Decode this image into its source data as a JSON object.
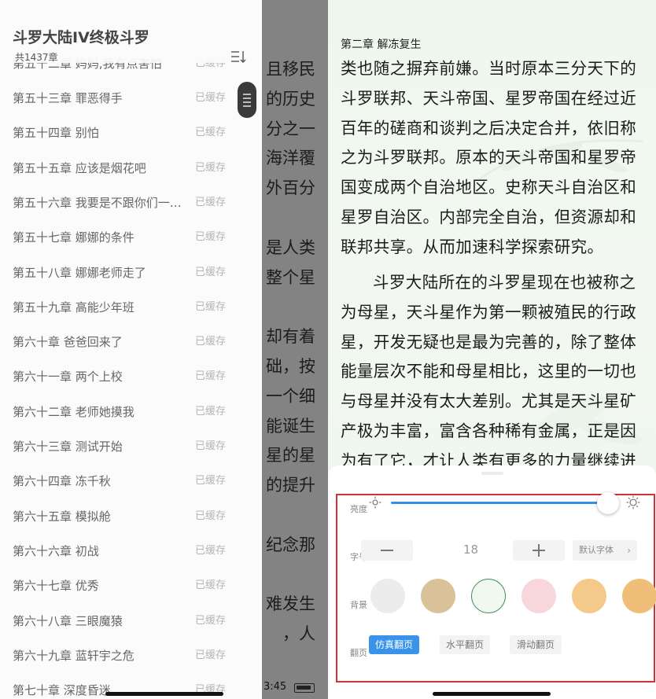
{
  "left_screen": {
    "book_title": "斗罗大陆IV终极斗罗",
    "chapter_count": "共1437章",
    "partial_top_row": {
      "title": "第五十二章 妈妈,我有点害怕",
      "status": "已缓存"
    },
    "chapters": [
      {
        "title": "第五十三章 罪恶得手",
        "status": "已缓存"
      },
      {
        "title": "第五十四章 别怕",
        "status": "已缓存"
      },
      {
        "title": "第五十五章 应该是烟花吧",
        "status": "已缓存"
      },
      {
        "title": "第五十六章 我要是不跟你们一起呢",
        "status": "已缓存"
      },
      {
        "title": "第五十七章 娜娜的条件",
        "status": "已缓存"
      },
      {
        "title": "第五十八章 娜娜老师走了",
        "status": "已缓存"
      },
      {
        "title": "第五十九章 高能少年班",
        "status": "已缓存"
      },
      {
        "title": "第六十章 爸爸回来了",
        "status": "已缓存"
      },
      {
        "title": "第六十一章 两个上校",
        "status": "已缓存"
      },
      {
        "title": "第六十二章 老师她摸我",
        "status": "已缓存"
      },
      {
        "title": "第六十三章 测试开始",
        "status": "已缓存"
      },
      {
        "title": "第六十四章 冻千秋",
        "status": "已缓存"
      },
      {
        "title": "第六十五章 模拟舱",
        "status": "已缓存"
      },
      {
        "title": "第六十六章 初战",
        "status": "已缓存"
      },
      {
        "title": "第六十七章 优秀",
        "status": "已缓存"
      },
      {
        "title": "第六十八章 三眼魔猿",
        "status": "已缓存"
      },
      {
        "title": "第六十九章 蓝轩宇之危",
        "status": "已缓存"
      },
      {
        "title": "第七十章 深度昏迷",
        "status": "已缓存"
      }
    ],
    "behind_text_lines": [
      "且移民",
      "的历史",
      "分之一",
      "海洋覆",
      "外百分",
      "",
      "是人类",
      "整个星",
      "",
      "却有着",
      "础，按",
      "一个细",
      "能诞生",
      "星的星",
      "的提升",
      "",
      "纪念那",
      "",
      "难发生",
      "，人"
    ],
    "status_time": "3:45"
  },
  "right_screen": {
    "chapter_heading": "第二章 解冻复生",
    "paragraph_1": "类也随之摒弃前嫌。当时原本三分天下的斗罗联邦、天斗帝国、星罗帝国在经过近百年的磋商和谈判之后决定合并，依旧称之为斗罗联邦。原本的天斗帝国和星罗帝国变成两个自治地区。史称天斗自治区和星罗自治区。内部完全自治，但资源却和联邦共享。从而加速科学探索研究。",
    "paragraph_2": "斗罗大陆所在的斗罗星现在也被称之为母星，天斗星作为第一颗被殖民的行政星，开发无疑也是最为完善的，除了整体能量层次不能和母星相比，这里的一切也与母星并没有太大差别。尤其是天斗星矿产极为丰富，富含各种稀有金属，正是因为有了它，才让人类有更多的力量继续进",
    "settings": {
      "brightness_label": "亮度",
      "brightness_level": 0.95,
      "font_label": "字号",
      "font_size": "18",
      "font_face": "默认字体",
      "background_label": "背景",
      "backgrounds": [
        {
          "name": "gray",
          "color": "#ececec",
          "selected": false
        },
        {
          "name": "khaki",
          "color": "#d9c29a",
          "selected": false
        },
        {
          "name": "green-leaf",
          "color": "#f1f8f0",
          "selected": true
        },
        {
          "name": "pink-blossom",
          "color": "#f8d7dc",
          "selected": false
        },
        {
          "name": "apricot",
          "color": "#f4c98a",
          "selected": false
        },
        {
          "name": "orange",
          "color": "#efbf7a",
          "selected": false
        }
      ],
      "page_label": "翻页",
      "page_modes": [
        {
          "label": "仿真翻页",
          "active": true
        },
        {
          "label": "水平翻页",
          "active": false
        },
        {
          "label": "滑动翻页",
          "active": false
        }
      ],
      "accent_color": "#3a93ea",
      "highlight_border": "#d0323a"
    }
  }
}
